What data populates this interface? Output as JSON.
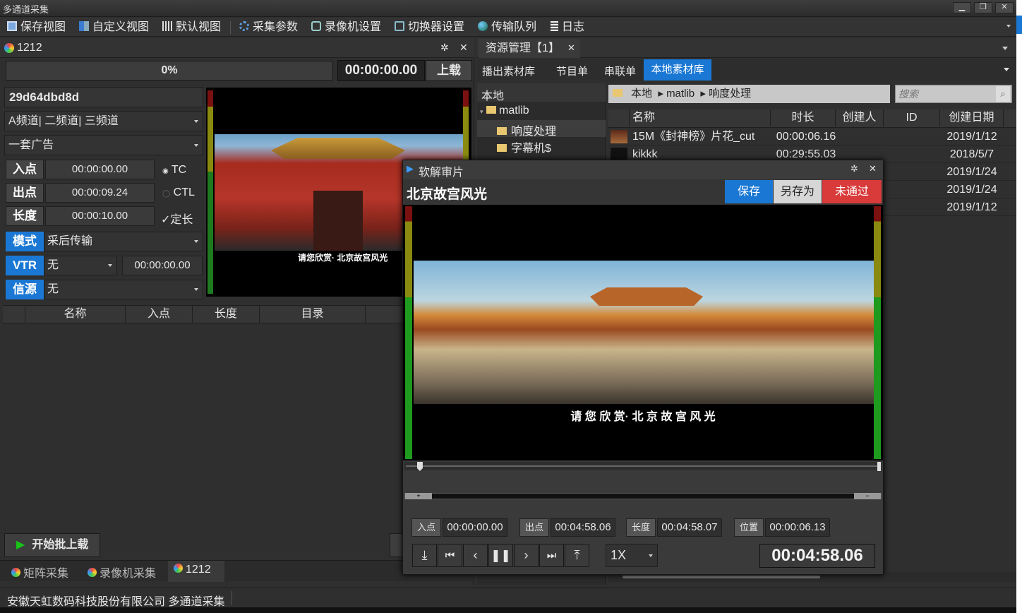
{
  "window": {
    "title": "多通道采集"
  },
  "toolbar": {
    "items": [
      {
        "label": "保存视图",
        "icon": "save-icon"
      },
      {
        "label": "自定义视图",
        "icon": "custom-view-icon"
      },
      {
        "label": "默认视图",
        "icon": "default-view-icon"
      },
      {
        "label": "采集参数",
        "icon": "gear-icon"
      },
      {
        "label": "录像机设置",
        "icon": "vcr-icon"
      },
      {
        "label": "切换器设置",
        "icon": "switcher-icon"
      },
      {
        "label": "传输队列",
        "icon": "globe-icon"
      },
      {
        "label": "日志",
        "icon": "log-icon"
      }
    ]
  },
  "capture": {
    "tab_title": "1212",
    "progress": "0%",
    "progress_value": 0,
    "timecode": "00:00:00.00",
    "upload_label": "上载",
    "clip_id": "29d64dbd8d",
    "channels": "A频道| 二频道| 三频道",
    "category": "一套广告",
    "in_label": "入点",
    "in_value": "00:00:00.00",
    "out_label": "出点",
    "out_value": "00:00:09.24",
    "len_label": "长度",
    "len_value": "00:00:10.00",
    "tc_label": "TC",
    "ctl_label": "CTL",
    "fixed_len_label": "定长",
    "mode_label": "模式",
    "mode_value": "采后传输",
    "vtr_label": "VTR",
    "vtr_value": "无",
    "vtr_tc": "00:00:00.00",
    "source_label": "信源",
    "source_value": "无",
    "preview_caption": "请您欣赏· 北京故宫风光",
    "list_columns": [
      "名称",
      "入点",
      "长度",
      "目录"
    ],
    "start_batch_label": "开始批上载"
  },
  "bottom_tabs": [
    "矩阵采集",
    "录像机采集",
    "1212"
  ],
  "status_bar": "安徽天虹数码科技股份有限公司 多通道采集",
  "resource": {
    "tab_title": "资源管理【1】",
    "subtabs": [
      "播出素材库",
      "节目单",
      "串联单",
      "本地素材库"
    ],
    "active_subtab": "本地素材库",
    "tree_root": "本地",
    "tree": [
      "matlib",
      "响度处理",
      "字幕机$"
    ],
    "breadcrumb": [
      "本地",
      "matlib",
      "响度处理"
    ],
    "search_placeholder": "搜索",
    "columns": [
      "名称",
      "时长",
      "创建人",
      "ID",
      "创建日期"
    ],
    "rows": [
      {
        "name": "15M《封神榜》片花_cut",
        "duration": "00:00:06.16",
        "date": "2019/1/12"
      },
      {
        "name": "kikkk",
        "duration": "00:29:55.03",
        "date": "2018/5/7"
      },
      {
        "name": "",
        "duration": "",
        "date": "2019/1/24"
      },
      {
        "name": "",
        "duration": "",
        "date": "2019/1/24"
      },
      {
        "name": "",
        "duration": "",
        "date": "2019/1/12"
      }
    ]
  },
  "review": {
    "title": "软解审片",
    "clip_name": "北京故宫风光",
    "save_label": "保存",
    "save_as_label": "另存为",
    "reject_label": "未通过",
    "caption": "请 您 欣 赏· 北 京 故 宫 风 光",
    "in_label": "入点",
    "in_value": "00:00:00.00",
    "out_label": "出点",
    "out_value": "00:04:58.06",
    "len_label": "长度",
    "len_value": "00:04:58.07",
    "pos_label": "位置",
    "pos_value": "00:00:06.13",
    "speed": "1X",
    "big_tc": "00:04:58.06",
    "playhead_fraction": 0.021
  }
}
